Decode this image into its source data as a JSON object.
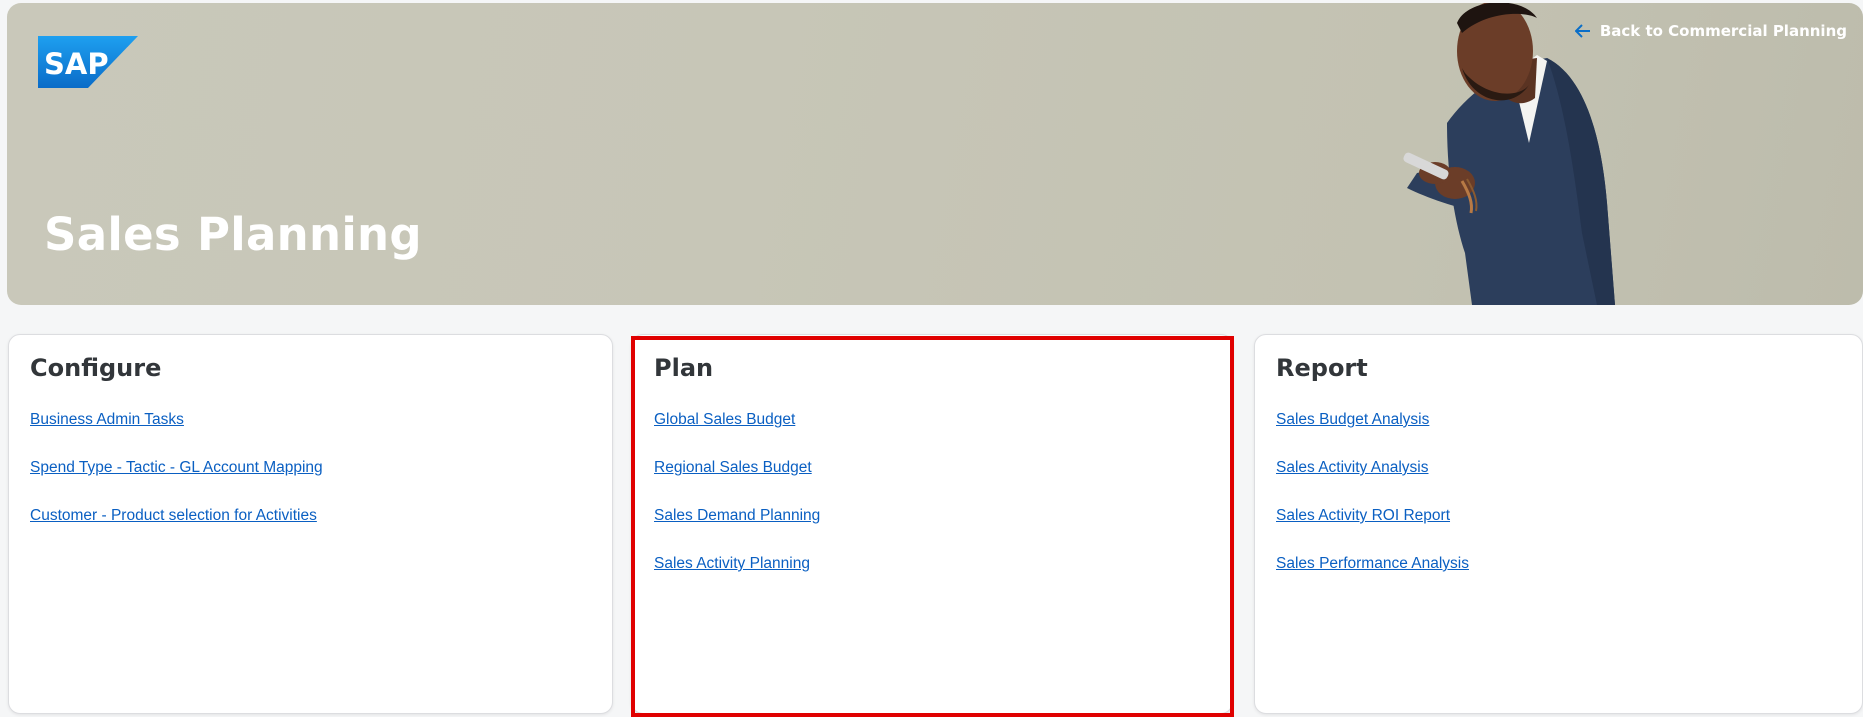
{
  "header": {
    "title": "Sales Planning",
    "logo_text": "SAP",
    "back_link": "Back to Commercial Planning"
  },
  "cards": [
    {
      "title": "Configure",
      "links": [
        "Business Admin Tasks",
        "Spend Type - Tactic - GL Account Mapping",
        "Customer - Product selection for Activities"
      ]
    },
    {
      "title": "Plan",
      "links": [
        "Global Sales Budget",
        "Regional Sales Budget",
        "Sales Demand Planning",
        "Sales Activity Planning"
      ]
    },
    {
      "title": "Report",
      "links": [
        "Sales Budget Analysis",
        "Sales Activity Analysis",
        "Sales Activity ROI Report",
        "Sales Performance Analysis"
      ]
    }
  ],
  "colors": {
    "link": "#0a5fc2",
    "highlight": "#e00000",
    "sap_blue": "#0a78d4"
  }
}
